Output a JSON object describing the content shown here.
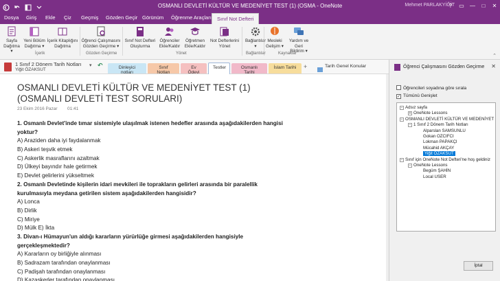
{
  "window": {
    "title": "OSMANLI DEVLETİ KÜLTÜR VE MEDENİYET TEST (1) (OSMA  -  OneNote",
    "user": "Mehmet PARLAKYİĞİT",
    "controls": [
      "?",
      "▭",
      "—",
      "□",
      "✕"
    ]
  },
  "ribbon_tabs": [
    "Dosya",
    "Giriş",
    "Ekle",
    "Çiz",
    "Geçmiş",
    "Gözden Geçir",
    "Görünüm",
    "Öğrenme Araçları",
    "Sınıf Not Defteri"
  ],
  "ribbon": {
    "buttons": [
      {
        "label1": "Sayfa",
        "label2": "Dağıtma ▾"
      },
      {
        "label1": "Yeni Bölüm",
        "label2": "Dağıtma ▾"
      },
      {
        "label1": "İçerik Kitaplığını",
        "label2": "Dağıtma"
      },
      {
        "label1": "Öğrenci Çalışmasını",
        "label2": "Gözden Geçirme ▾"
      },
      {
        "label1": "Sınıf Not Defteri",
        "label2": "Oluşturma"
      },
      {
        "label1": "Öğrenciler",
        "label2": "Ekle/Kaldır"
      },
      {
        "label1": "Öğretmen",
        "label2": "Ekle/Kaldır"
      },
      {
        "label1": "Not Defterlerini",
        "label2": "Yönet"
      },
      {
        "label1": "Bağlantılar",
        "label2": "▾"
      },
      {
        "label1": "Mesleki",
        "label2": "Gelişim ▾"
      },
      {
        "label1": "Yardım ve Geri",
        "label2": "Bildirim ▾"
      }
    ],
    "groups": [
      "İçerik",
      "Gözden Geçirme",
      "Yönet",
      "Bağlantılar",
      "Kaynaklar"
    ]
  },
  "nav": {
    "notebook": "1 Sınıf 2 Dönem Tarih Notları",
    "user": "Yiğit ÖZAKSUT",
    "sections": [
      "Dinleyici notları",
      "Sınıf Notları",
      "Ev Ödevi",
      "Testler",
      "Osmanlı Tarihi",
      "İslam Tarihi"
    ],
    "section_colors": [
      "#c9e6f5",
      "#f6c8a8",
      "#f5c0c0",
      "#c7d9ee",
      "#f1b9c9",
      "#f7dd9c"
    ],
    "add": "+",
    "link": "Tarih Genel Konular"
  },
  "page": {
    "title_line1": "OSMANLI DEVLETİ KÜLTÜR VE MEDENİYET TEST (1)",
    "title_line2": "(OSMANLI DEVLETİ TEST SORULARI)",
    "date": "23 Ekim 2016 Pazar",
    "time": "01:41",
    "lines": [
      {
        "t": "1. Osmanlı Devlet'inde tımar sistemiyle ulaşılmak istenen hedefler arasında aşağıdakilerden hangisi",
        "q": true
      },
      {
        "t": "yoktur?",
        "q": true
      },
      {
        "t": "A) Araziden daha iyi faydalanmak",
        "q": false
      },
      {
        "t": "B) Askeri teşvik etmek",
        "q": false
      },
      {
        "t": "C) Askerlik masraflarını azaltmak",
        "q": false
      },
      {
        "t": "D) Ülkeyi bayındır hale getirmek",
        "q": false
      },
      {
        "t": "E) Devlet gelirlerini yükseltmek",
        "q": false
      },
      {
        "t": "2. Osmanlı Devletinde kişilerin idari mevkileri ile toprakların gelirleri arasında bir paralellik",
        "q": true
      },
      {
        "t": "kurulmasıyla meydana getirilen sistem aşağıdakilerden hangisidir?",
        "q": true
      },
      {
        "t": "A) Lonca",
        "q": false
      },
      {
        "t": "B) Dirlik",
        "q": false
      },
      {
        "t": "C) Miriye",
        "q": false
      },
      {
        "t": "D) Mülk E) İkta",
        "q": false
      },
      {
        "t": "3. Divan-ı Hümayun'un aldığı kararların yürürlüğe girmesi aşağıdakilerden hangisiyle",
        "q": true
      },
      {
        "t": "gerçekleşmektedir?",
        "q": true
      },
      {
        "t": "A) Kararların oy birliğiyle alınması",
        "q": false
      },
      {
        "t": "B) Sadrazam tarafından onaylanması",
        "q": false
      },
      {
        "t": "C) Padişah tarafından onaylanması",
        "q": false
      },
      {
        "t": "D) Kazaskerler tarafından onaylanması",
        "q": false
      }
    ]
  },
  "pane": {
    "title": "Öğrenci Çalışmasını Gözden Geçirme",
    "checkbox1": "Öğrencileri soyadına göre sırala",
    "checkbox2": "Tümünü Genişlet",
    "checkbox2_checked": "✓",
    "tree": [
      {
        "label": "Adsız sayfa",
        "depth": 0,
        "ex": "⊟"
      },
      {
        "label": "OneNote Lessons",
        "depth": 1,
        "ex": "⊞"
      },
      {
        "label": "OSMANLI DEVLETİ KÜLTÜR VE MEDENİYET",
        "depth": 0,
        "ex": "⊟"
      },
      {
        "label": "1 Sınıf 2 Dönem Tarih Notları",
        "depth": 1,
        "ex": "⊟"
      },
      {
        "label": "Alparslan SAMSUNLU",
        "depth": 2,
        "ex": ""
      },
      {
        "label": "Gokan OZCIFCI",
        "depth": 2,
        "ex": ""
      },
      {
        "label": "Lokman PAPAKÇI",
        "depth": 2,
        "ex": ""
      },
      {
        "label": "Mücahid AKÇAY",
        "depth": 2,
        "ex": ""
      },
      {
        "label": "Yiğit ÖZAKSUT",
        "depth": 2,
        "ex": "",
        "selected": true
      },
      {
        "label": "Sınıf için OneNote Not Defteri'ne hoş geldiniz",
        "depth": 0,
        "ex": "⊟"
      },
      {
        "label": "OneNote Lessons",
        "depth": 1,
        "ex": "⊟"
      },
      {
        "label": "Begüm ŞAHİN",
        "depth": 2,
        "ex": ""
      },
      {
        "label": "Local USER",
        "depth": 2,
        "ex": ""
      }
    ],
    "cancel": "İptal"
  }
}
